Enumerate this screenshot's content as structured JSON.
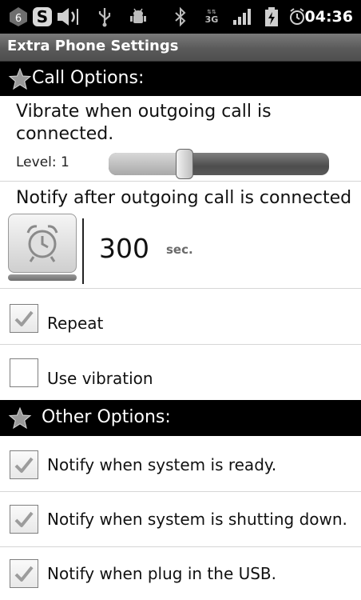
{
  "statusbar": {
    "time": "04:36",
    "icons": [
      "notification-count-icon",
      "s-app-icon",
      "volume-icon",
      "usb-icon",
      "android-debug-icon",
      "bluetooth-icon",
      "3g-data-icon",
      "signal-icon",
      "battery-icon",
      "alarm-icon"
    ],
    "notification_count": "6",
    "s_letter": "S",
    "network_label": "3G"
  },
  "app": {
    "title": "Extra Phone Settings"
  },
  "sections": {
    "call": {
      "label": "Call Options:"
    },
    "other": {
      "label": "Other Options:"
    }
  },
  "vibrate": {
    "label": "Vibrate when outgoing call is connected.",
    "line1": "Vibrate when outgoing call is",
    "line2": "connected.",
    "level_label": "Level: 1",
    "level_fraction": 0.3
  },
  "notify": {
    "label": "Notify after outgoing call is connected",
    "value": "300",
    "unit": "sec."
  },
  "options": {
    "repeat": {
      "label": "Repeat",
      "checked": true
    },
    "use_vibration": {
      "label": "Use vibration",
      "checked": false
    },
    "system_ready": {
      "label": "Notify when system is ready.",
      "checked": true
    },
    "shutting_down": {
      "label": "Notify when system is shutting down.",
      "checked": true
    },
    "plug_usb": {
      "label": "Notify when plug in the USB.",
      "checked": true
    }
  },
  "colors": {
    "section_bg": "#000000",
    "titlebar": "#5f5f5f",
    "check": "#9c9c9c"
  }
}
